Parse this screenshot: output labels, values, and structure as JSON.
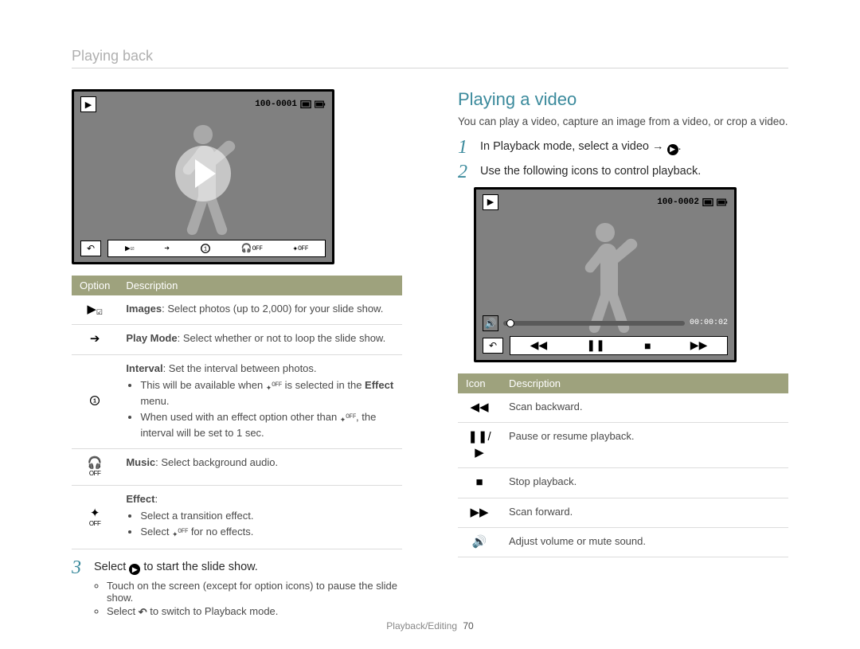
{
  "header": "Playing back",
  "footer": {
    "section": "Playback/Editing",
    "page": "70"
  },
  "left": {
    "screen": {
      "counter": "100-0001"
    },
    "table": {
      "th_option": "Option",
      "th_desc": "Description",
      "rows": [
        {
          "label_strong": "Images",
          "label_rest": ": Select photos (up to 2,000) for your slide show."
        },
        {
          "label_strong": "Play Mode",
          "label_rest": ": Select whether or not to loop the slide show."
        },
        {
          "label_strong": "Interval",
          "label_rest": ": Set the interval between photos.",
          "bullets_pre": "This will be available when ",
          "bullets_post": " is selected in the ",
          "bullets_post2": "Effect",
          "bullets_post3": " menu.",
          "bullet2_pre": "When used with an effect option other than ",
          "bullet2_post": ", the interval will be set to 1 sec."
        },
        {
          "label_strong": "Music",
          "label_rest": ": Select background audio."
        },
        {
          "label_strong": "Effect",
          "label_rest": ":",
          "b1": "Select a transition effect.",
          "b2_pre": "Select ",
          "b2_post": " for no effects."
        }
      ]
    },
    "step3": {
      "main_pre": "Select ",
      "main_post": " to start the slide show.",
      "sub1": "Touch on the screen (except for option icons) to pause the slide show.",
      "sub2_pre": "Select ",
      "sub2_post": " to switch to Playback mode."
    }
  },
  "right": {
    "title": "Playing a video",
    "intro": "You can play a video, capture an image from a video, or crop a video.",
    "step1_pre": "In Playback mode, select a video → ",
    "step1_post": ".",
    "step2": "Use the following icons to control playback.",
    "screen": {
      "counter": "100-0002",
      "time": "00:00:02"
    },
    "table": {
      "th_icon": "Icon",
      "th_desc": "Description",
      "rows": [
        {
          "desc": "Scan backward."
        },
        {
          "desc": "Pause or resume playback."
        },
        {
          "desc": "Stop playback."
        },
        {
          "desc": "Scan forward."
        },
        {
          "desc": "Adjust volume or mute sound."
        }
      ]
    }
  }
}
